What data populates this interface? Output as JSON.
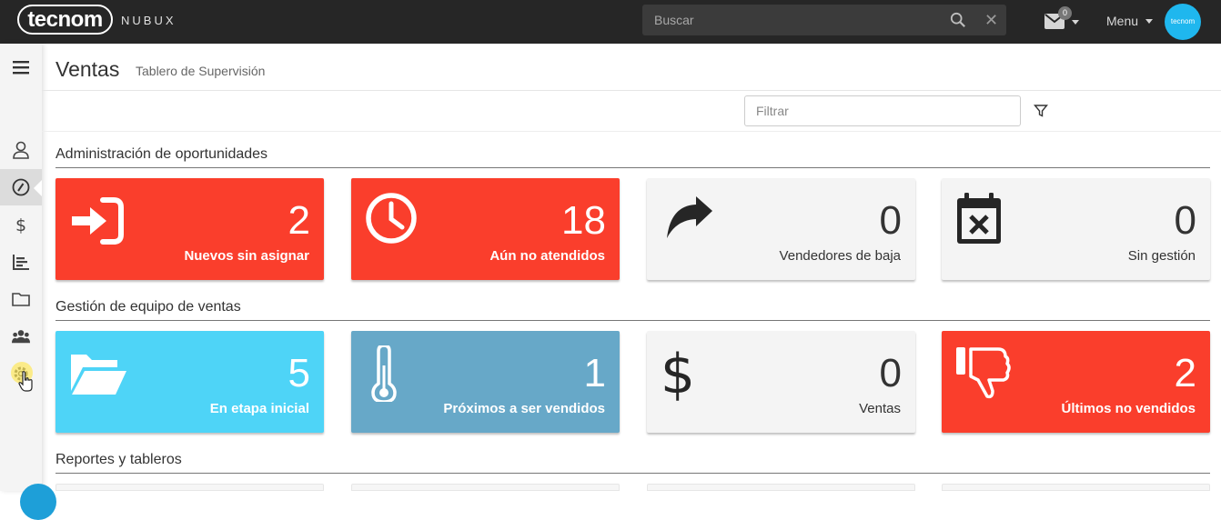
{
  "topbar": {
    "logo_text": "tecnom",
    "product": "NUBUX",
    "search_placeholder": "Buscar",
    "mail_badge": "0",
    "menu_label": "Menu",
    "avatar_text": "tecnom"
  },
  "page": {
    "title": "Ventas",
    "subtitle": "Tablero de Supervisión",
    "filter_placeholder": "Filtrar"
  },
  "sections": [
    {
      "title": "Administración de oportunidades",
      "cards": [
        {
          "icon": "sign-in-icon",
          "value": "2",
          "label": "Nuevos sin asignar",
          "color": "#fa3e2c"
        },
        {
          "icon": "clock-icon",
          "value": "18",
          "label": "Aún no atendidos",
          "color": "#fa3e2c"
        },
        {
          "icon": "share-arrow-icon",
          "value": "0",
          "label": "Vendedores de baja",
          "color": "#f4f4f4"
        },
        {
          "icon": "calendar-x-icon",
          "value": "0",
          "label": "Sin gestión",
          "color": "#f4f4f4"
        }
      ]
    },
    {
      "title": "Gestión de equipo de ventas",
      "cards": [
        {
          "icon": "folder-open-icon",
          "value": "5",
          "label": "En etapa inicial",
          "color": "#4ed4f7"
        },
        {
          "icon": "thermometer-icon",
          "value": "1",
          "label": "Próximos a ser vendidos",
          "color": "#67a8c8"
        },
        {
          "icon": "dollar-icon",
          "value": "0",
          "label": "Ventas",
          "color": "#f4f4f4"
        },
        {
          "icon": "thumbs-down-icon",
          "value": "2",
          "label": "Últimos no vendidos",
          "color": "#fa3e2c"
        }
      ]
    },
    {
      "title": "Reportes y tableros",
      "cards": []
    }
  ],
  "sidebar": {
    "items": [
      "hamburger-icon",
      "user-icon",
      "dashboard-icon",
      "dollar-icon",
      "bar-chart-icon",
      "folder-icon",
      "users-icon",
      "settings-icon"
    ]
  }
}
